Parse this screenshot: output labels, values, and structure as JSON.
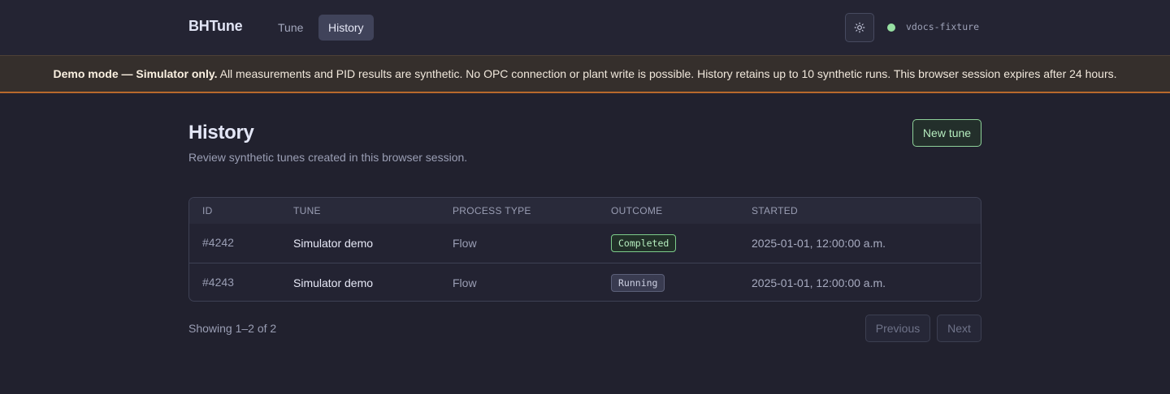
{
  "app": {
    "brand": "BHTune"
  },
  "nav": {
    "tabs": [
      {
        "label": "Tune",
        "active": false
      },
      {
        "label": "History",
        "active": true
      }
    ]
  },
  "header": {
    "theme_icon": "sun-icon",
    "status_color": "#97e0a2",
    "environment": "vdocs-fixture"
  },
  "banner": {
    "strong": "Demo mode — Simulator only.",
    "text": " All measurements and PID results are synthetic. No OPC connection or plant write is possible. History retains up to 10 synthetic runs. This browser session expires after 24 hours."
  },
  "page": {
    "title": "History",
    "subtitle": "Review synthetic tunes created in this browser session.",
    "new_button": "New tune"
  },
  "table": {
    "headers": [
      "ID",
      "TUNE",
      "PROCESS TYPE",
      "OUTCOME",
      "STARTED"
    ],
    "rows": [
      {
        "id": "#4242",
        "tune": "Simulator demo",
        "type": "Flow",
        "outcome": "Completed",
        "started": "2025-01-01, 12:00:00 a.m."
      },
      {
        "id": "#4243",
        "tune": "Simulator demo",
        "type": "Flow",
        "outcome": "Running",
        "started": "2025-01-01, 12:00:00 a.m."
      }
    ]
  },
  "pagination": {
    "summary": "Showing 1–2 of 2",
    "previous": "Previous",
    "next": "Next"
  },
  "colors": {
    "accent_green": "#8ed199",
    "banner_border": "#b8692c"
  }
}
